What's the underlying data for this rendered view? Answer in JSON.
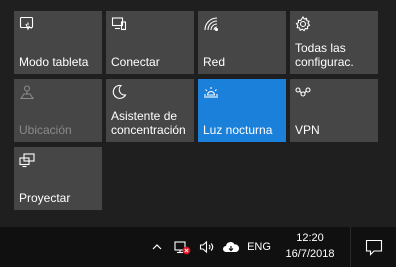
{
  "action_center": {
    "tiles": [
      {
        "label": "Modo tableta",
        "icon": "tablet-mode-icon",
        "state": "normal"
      },
      {
        "label": "Conectar",
        "icon": "connect-icon",
        "state": "normal"
      },
      {
        "label": "Red",
        "icon": "network-icon",
        "state": "normal"
      },
      {
        "label": "Todas las\nconfigurac.",
        "icon": "settings-icon",
        "state": "normal"
      },
      {
        "label": "Ubicación",
        "icon": "location-icon",
        "state": "disabled"
      },
      {
        "label": "Asistente de\nconcentración",
        "icon": "moon-icon",
        "state": "normal"
      },
      {
        "label": "Luz nocturna",
        "icon": "night-light-icon",
        "state": "active"
      },
      {
        "label": "VPN",
        "icon": "vpn-icon",
        "state": "normal"
      },
      {
        "label": "Proyectar",
        "icon": "project-icon",
        "state": "normal"
      }
    ]
  },
  "taskbar": {
    "language": "ENG",
    "time": "12:20",
    "date": "16/7/2018",
    "tray_icons": [
      "chevron-up-icon",
      "network-disconnected-icon",
      "volume-icon",
      "onedrive-icon"
    ],
    "notification_icon": "notification-center-icon"
  },
  "colors": {
    "tile_bg": "#464646",
    "tile_active_bg": "#1a80d9",
    "tile_disabled_text": "#8a8a8a",
    "taskbar_bg": "#101010",
    "network_error": "#e81123"
  }
}
